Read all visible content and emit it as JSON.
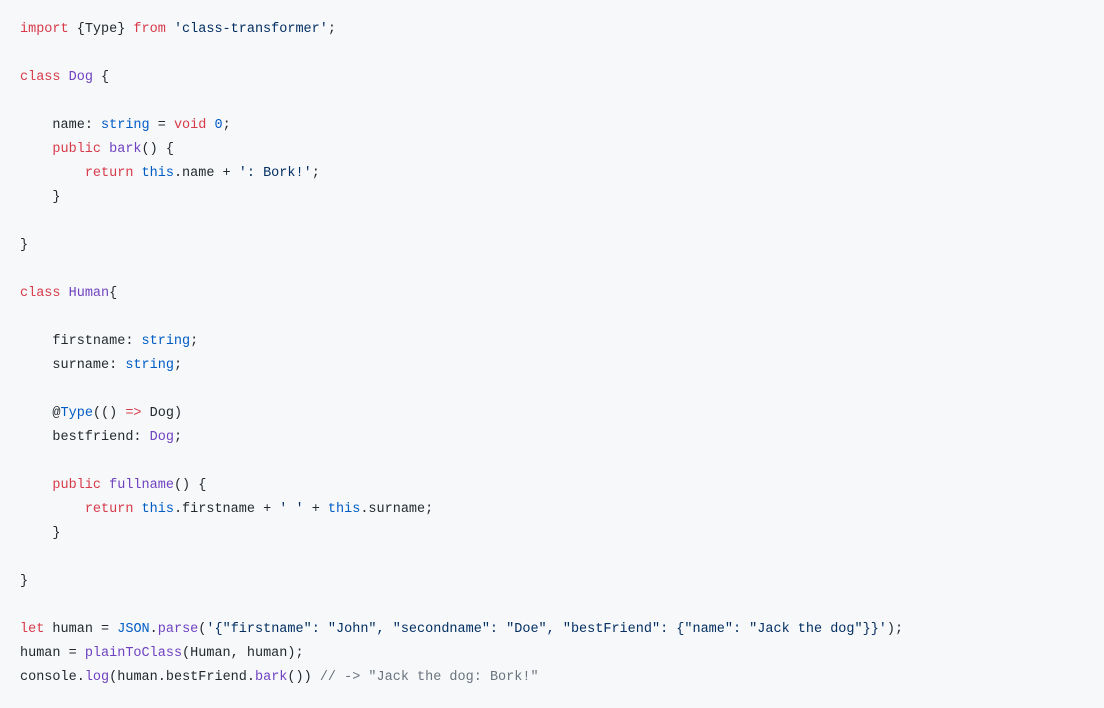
{
  "code": {
    "l1_import": "import",
    "l1_type": "Type",
    "l1_from": "from",
    "l1_mod": "'class-transformer'",
    "l3_class": "class",
    "l3_Dog": "Dog",
    "l5_name": "name",
    "l5_string": "string",
    "l5_void": "void",
    "l5_zero": "0",
    "l6_public": "public",
    "l6_bark": "bark",
    "l7_return": "return",
    "l7_this": "this",
    "l7_name": "name",
    "l7_str": "': Bork!'",
    "l11_class": "class",
    "l11_Human": "Human",
    "l13_firstname": "firstname",
    "l13_string": "string",
    "l14_surname": "surname",
    "l14_string": "string",
    "l16_Type": "Type",
    "l16_Dog": "Dog",
    "l17_bestfriend": "bestfriend",
    "l17_Dog": "Dog",
    "l19_public": "public",
    "l19_fullname": "fullname",
    "l20_return": "return",
    "l20_this1": "this",
    "l20_firstname": "firstname",
    "l20_sp": "' '",
    "l20_this2": "this",
    "l20_surname": "surname",
    "l24_let": "let",
    "l24_human": "human",
    "l24_JSON": "JSON",
    "l24_parse": "parse",
    "l24_json": "'{\"firstname\": \"John\", \"secondname\": \"Doe\", \"bestFriend\": {\"name\": \"Jack the dog\"}}'",
    "l25_human": "human",
    "l25_plainToClass": "plainToClass",
    "l25_Human": "Human",
    "l25_human2": "human",
    "l26_console": "console",
    "l26_log": "log",
    "l26_human": "human",
    "l26_bestFriend": "bestFriend",
    "l26_bark": "bark",
    "l26_comment": "// -> \"Jack the dog: Bork!\""
  }
}
